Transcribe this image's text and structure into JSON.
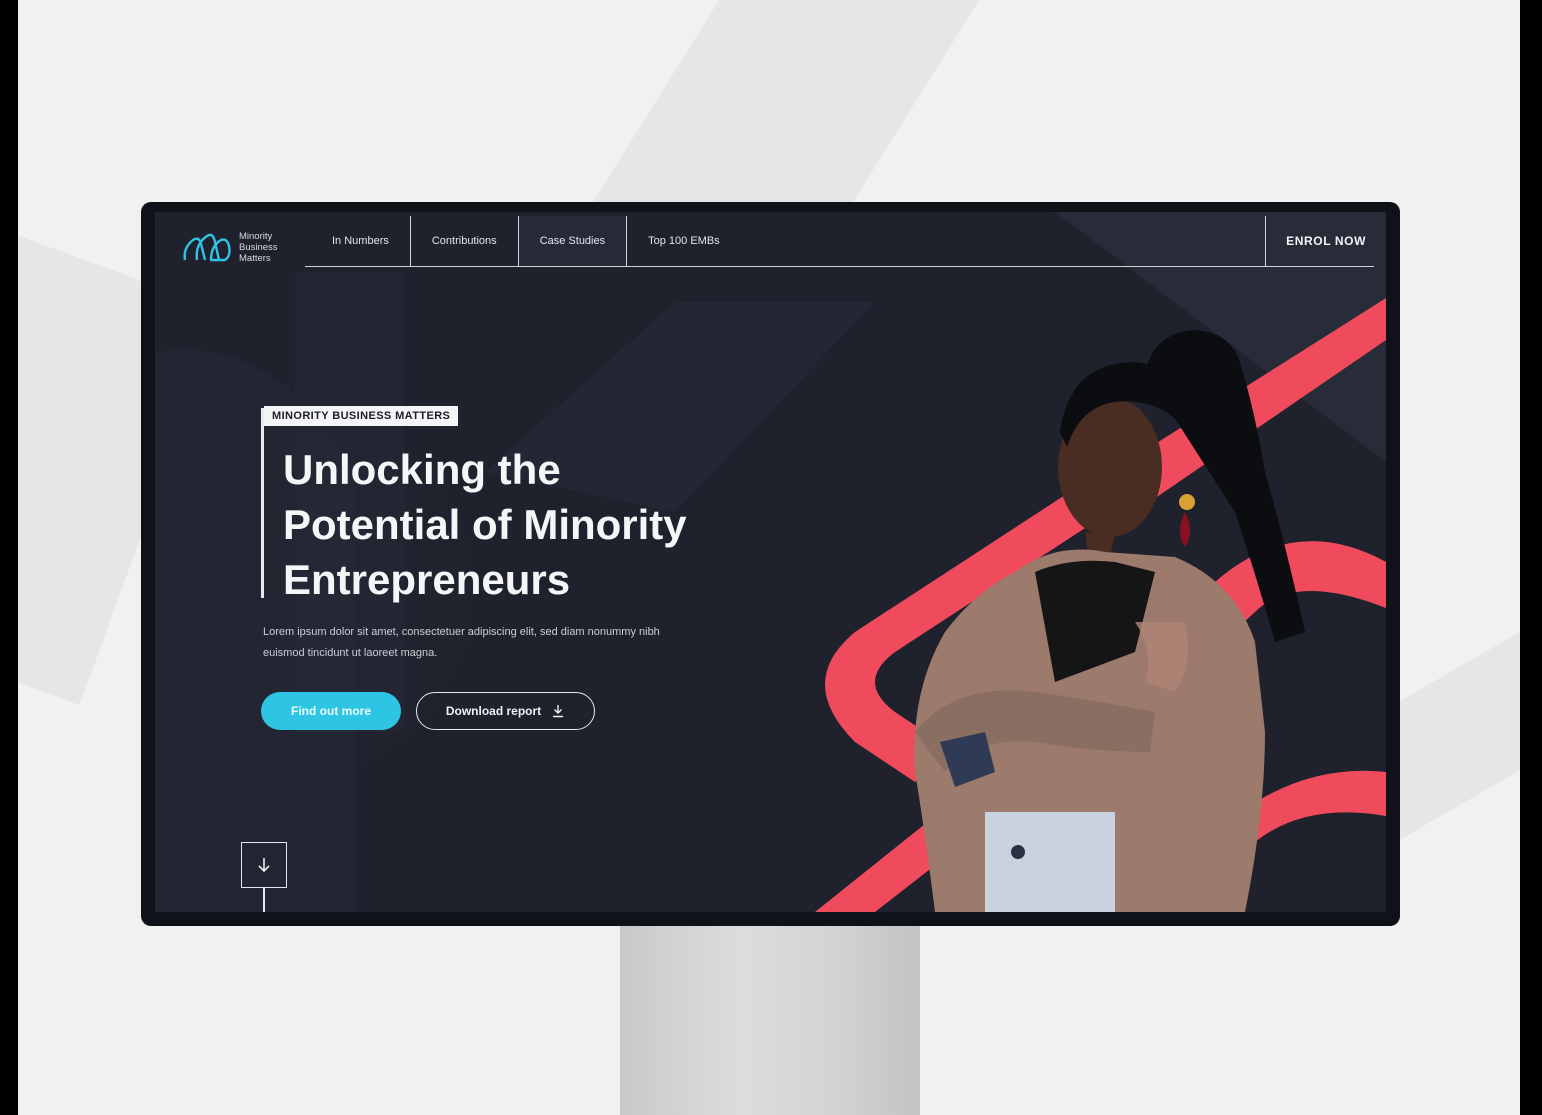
{
  "brand": {
    "name_lines": [
      "Minority",
      "Business",
      "Matters"
    ],
    "accent": "#2ec5e4",
    "highlight": "#ef4b5c"
  },
  "nav": {
    "items": [
      {
        "label": "In Numbers"
      },
      {
        "label": "Contributions"
      },
      {
        "label": "Case Studies"
      },
      {
        "label": "Top 100 EMBs"
      }
    ],
    "cta": "ENROL NOW"
  },
  "hero": {
    "tag": "MINORITY BUSINESS MATTERS",
    "headline_lines": [
      "Unlocking the",
      "Potential of Minority",
      "Entrepreneurs"
    ],
    "subtext": "Lorem ipsum dolor sit amet, consectetuer adipiscing elit, sed diam nonummy nibh euismod tincidunt ut laoreet magna.",
    "primary_button": "Find out more",
    "secondary_button": "Download report"
  },
  "icons": {
    "logo": "brand-logo-icon",
    "download": "download-icon",
    "scroll": "arrow-down-icon"
  }
}
